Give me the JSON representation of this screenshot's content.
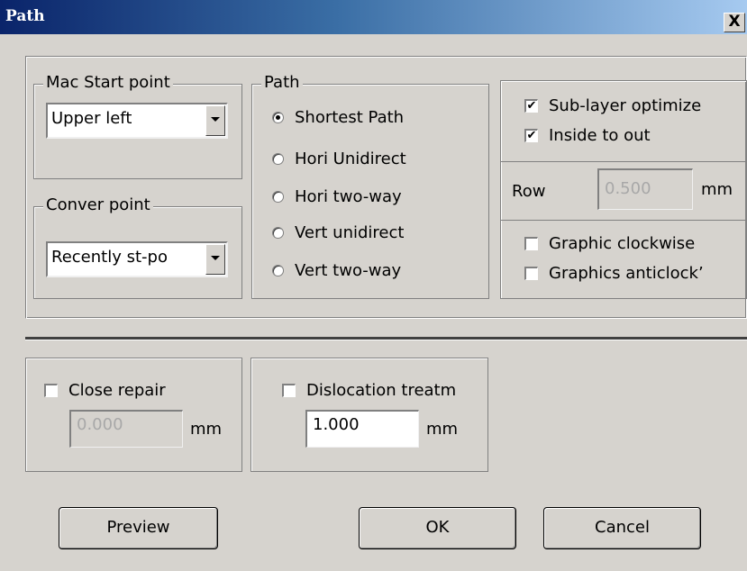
{
  "window": {
    "title": "Path",
    "close": "X"
  },
  "start_point": {
    "label": "Mac Start point",
    "value": "Upper left"
  },
  "conver_point": {
    "label": "Conver point",
    "value": "Recently st-po"
  },
  "path": {
    "label": "Path",
    "options": [
      {
        "label": "Shortest Path",
        "selected": true
      },
      {
        "label": "Hori Unidirect",
        "selected": false
      },
      {
        "label": "Hori two-way",
        "selected": false
      },
      {
        "label": "Vert unidirect",
        "selected": false
      },
      {
        "label": "Vert two-way",
        "selected": false
      }
    ]
  },
  "options": {
    "sub_layer": {
      "label": "Sub-layer optimize",
      "checked": true
    },
    "inside_out": {
      "label": "Inside to out",
      "checked": true
    },
    "row_label": "Row",
    "row_value": "0.500",
    "row_unit": "mm",
    "graphic_cw": {
      "label": "Graphic clockwise",
      "checked": false
    },
    "graphic_ccw": {
      "label": "Graphics anticlock’",
      "checked": false
    }
  },
  "close_repair": {
    "label": "Close repair",
    "checked": false,
    "value": "0.000",
    "unit": "mm"
  },
  "dislocation": {
    "label": "Dislocation treatm",
    "checked": false,
    "value": "1.000",
    "unit": "mm"
  },
  "buttons": {
    "preview": "Preview",
    "ok": "OK",
    "cancel": "Cancel"
  }
}
